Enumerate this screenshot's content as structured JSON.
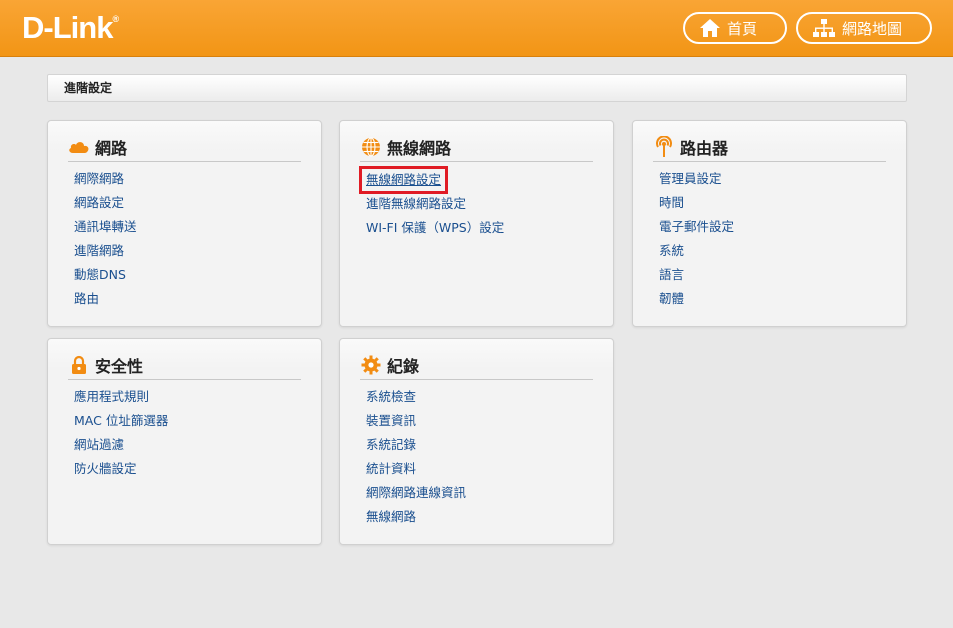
{
  "header": {
    "logo": "D-Link",
    "logo_mark": "®",
    "home_label": "首頁",
    "map_label": "網路地圖"
  },
  "breadcrumb": "進階設定",
  "panels": {
    "network": {
      "title": "網路",
      "icon": "cloud-icon",
      "items": [
        "網際網路",
        "網路設定",
        "通訊埠轉送",
        "進階網路",
        "動態DNS",
        "路由"
      ]
    },
    "wireless": {
      "title": "無線網路",
      "icon": "globe-icon",
      "items": [
        "無線網路設定",
        "進階無線網路設定",
        "WI-FI 保護（WPS）設定"
      ],
      "highlighted_index": 0
    },
    "router": {
      "title": "路由器",
      "icon": "antenna-icon",
      "items": [
        "管理員設定",
        "時間",
        "電子郵件設定",
        "系統",
        "語言",
        "韌體"
      ]
    },
    "security": {
      "title": "安全性",
      "icon": "lock-icon",
      "items": [
        "應用程式規則",
        "MAC 位址篩選器",
        "網站過濾",
        "防火牆設定"
      ]
    },
    "logs": {
      "title": "紀錄",
      "icon": "gear-icon",
      "items": [
        "系統檢查",
        "裝置資訊",
        "系統記錄",
        "統計資料",
        "網際網路連線資訊",
        "無線網路"
      ]
    }
  },
  "colors": {
    "header": "#f29515",
    "link": "#1a4f8f",
    "highlight": "#e01b24",
    "icon": "#f28c12"
  }
}
